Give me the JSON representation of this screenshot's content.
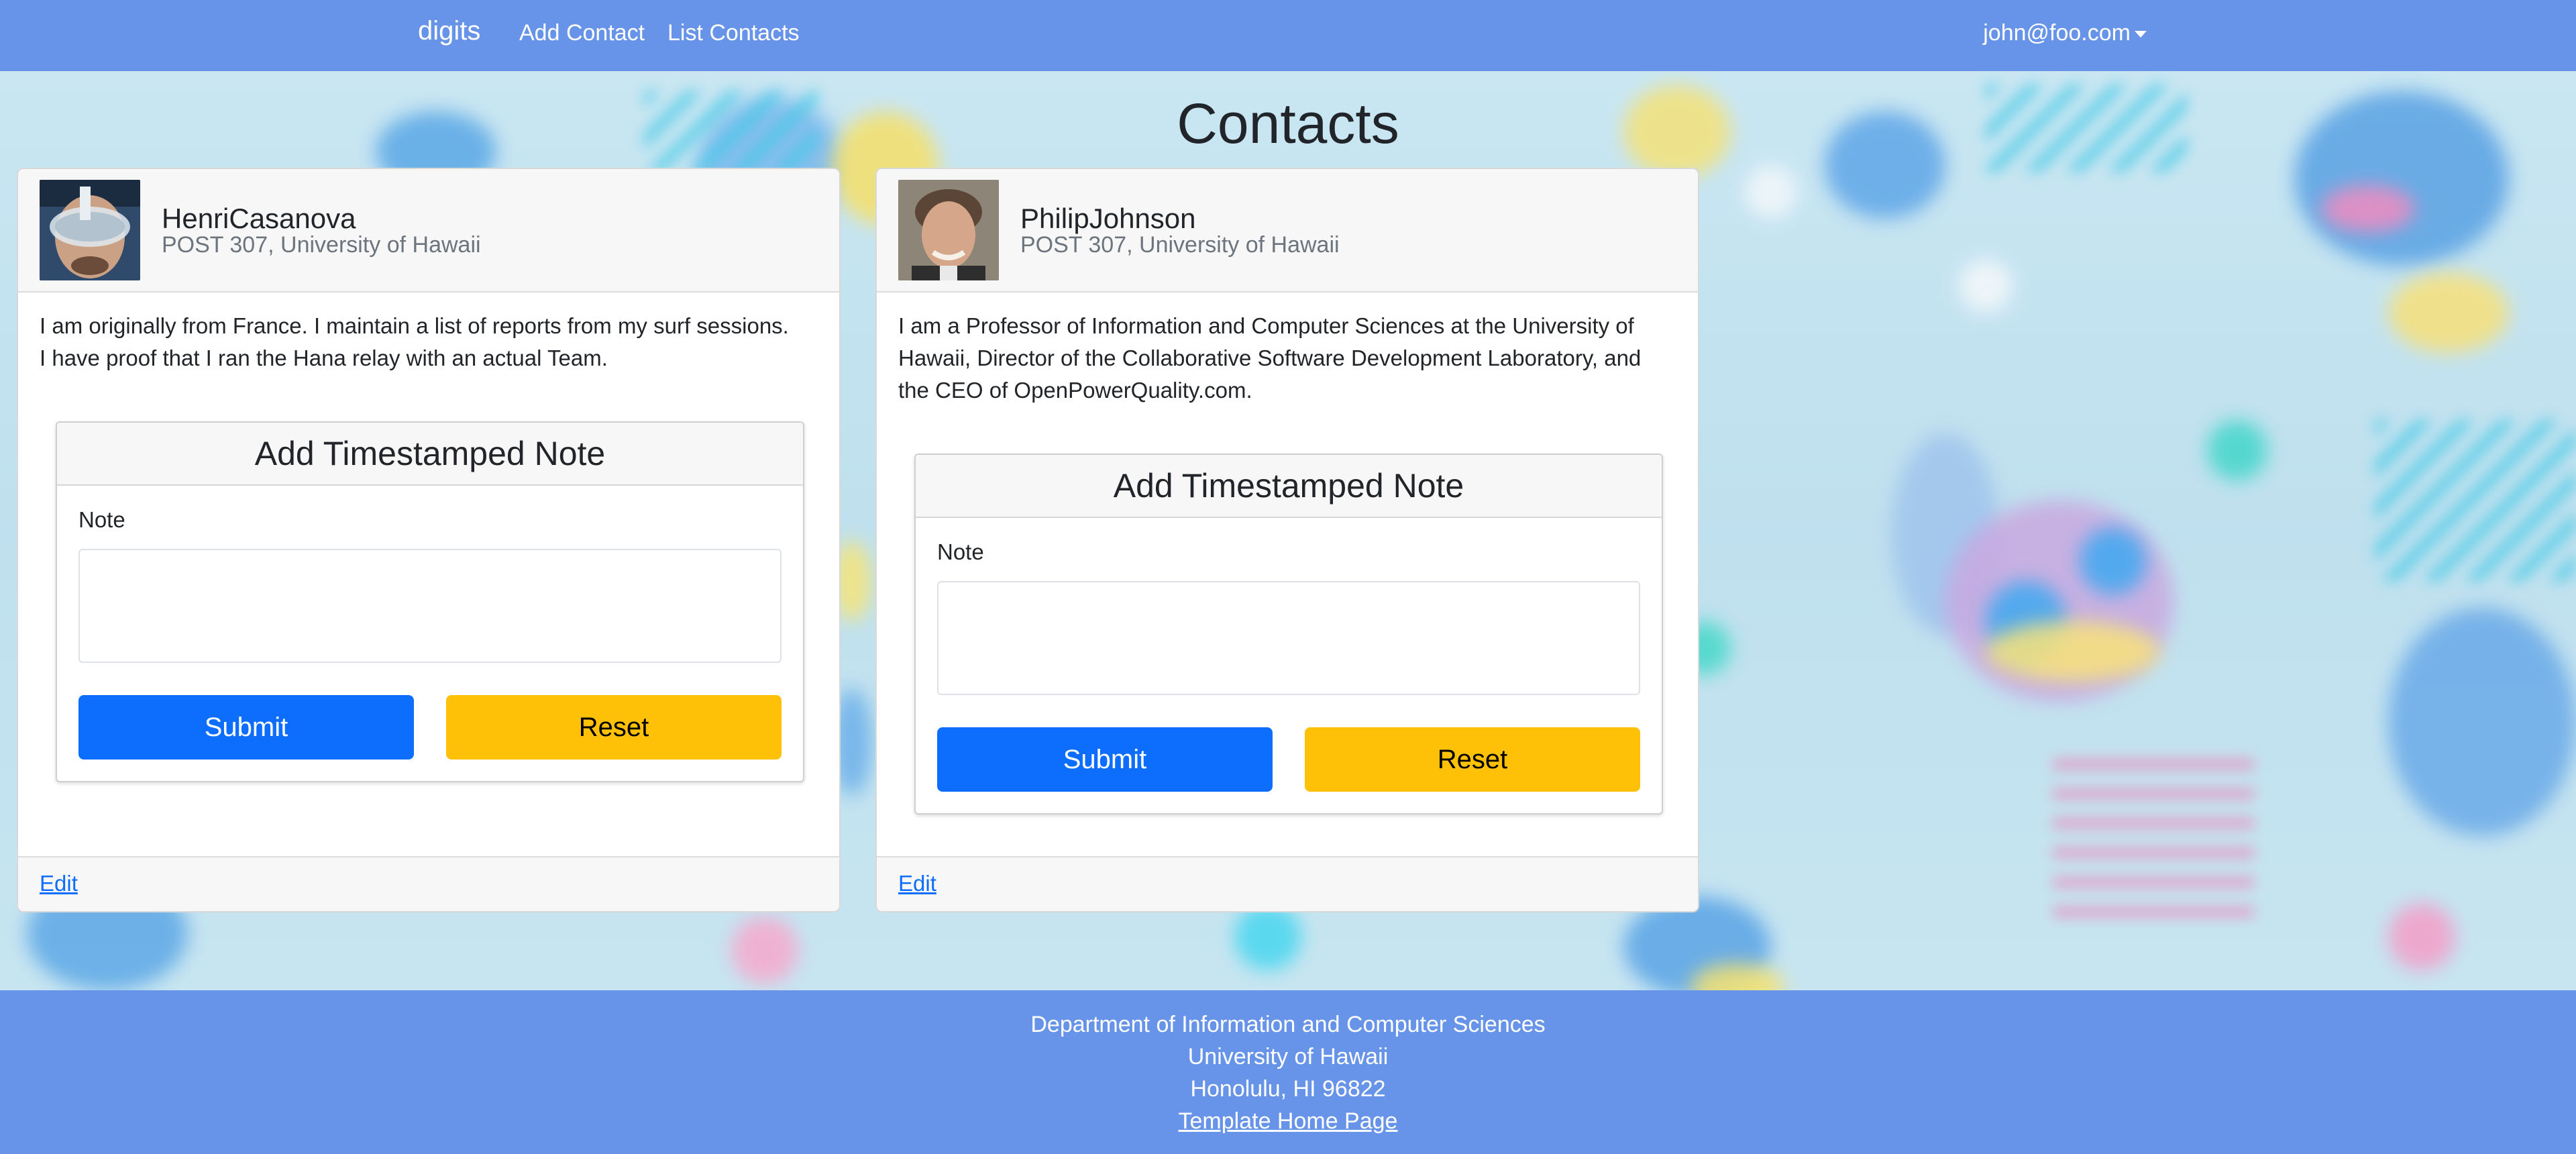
{
  "navbar": {
    "brand": "digits",
    "links": [
      "Add Contact",
      "List Contacts"
    ],
    "user": "john@foo.com"
  },
  "page": {
    "title": "Contacts"
  },
  "contacts": [
    {
      "name": "HenriCasanova",
      "address": "POST 307, University of Hawaii",
      "description_lines": [
        "I am originally from France. I maintain a list of reports from my surf sessions.",
        "I have proof that I ran the Hana relay with an actual Team."
      ],
      "form_title": "Add Timestamped Note",
      "note_label": "Note",
      "submit_label": "Submit",
      "reset_label": "Reset",
      "edit_label": "Edit"
    },
    {
      "name": "PhilipJohnson",
      "address": "POST 307, University of Hawaii",
      "description_lines": [
        "I am a Professor of Information and Computer Sciences at the University of",
        "Hawaii, Director of the Collaborative Software Development Laboratory, and",
        "the CEO of OpenPowerQuality.com."
      ],
      "form_title": "Add Timestamped Note",
      "note_label": "Note",
      "submit_label": "Submit",
      "reset_label": "Reset",
      "edit_label": "Edit"
    }
  ],
  "footer": {
    "lines": [
      "Department of Information and Computer Sciences",
      "University of Hawaii",
      "Honolulu, HI 96822"
    ],
    "link_text": "Template Home Page"
  },
  "colors": {
    "navbar": "#6794e8",
    "submit": "#0d6efd",
    "reset": "#ffc107",
    "link": "#0d6efd"
  }
}
